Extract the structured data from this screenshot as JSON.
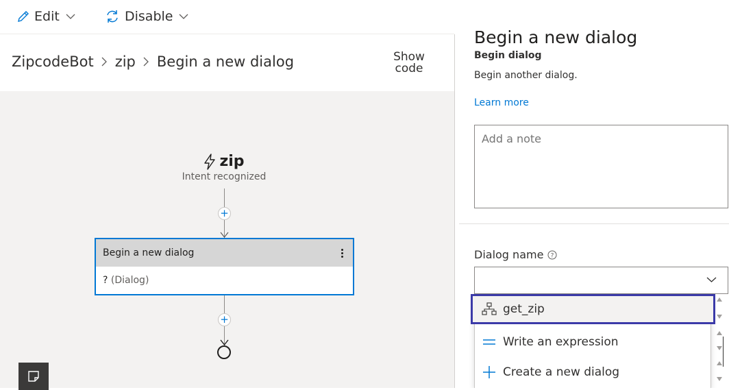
{
  "toolbar": {
    "edit_label": "Edit",
    "disable_label": "Disable"
  },
  "header": {
    "breadcrumb": [
      "ZipcodeBot",
      "zip",
      "Begin a new dialog"
    ],
    "show_code_line1": "Show",
    "show_code_line2": "code"
  },
  "canvas": {
    "trigger_title": "zip",
    "trigger_subtitle": "Intent recognized",
    "node": {
      "title": "Begin a new dialog",
      "body_prefix": "?",
      "body_value": "(Dialog)"
    }
  },
  "panel": {
    "title": "Begin a new dialog",
    "subtitle": "Begin dialog",
    "description": "Begin another dialog.",
    "learn_more": "Learn more",
    "note_placeholder": "Add a note",
    "dialog_name_label": "Dialog name",
    "dialog_name_value": "",
    "dropdown": {
      "items": [
        {
          "label": "get_zip",
          "icon": "dialog-tree-icon",
          "selected": true
        },
        {
          "label": "Write an expression",
          "icon": "expression-icon",
          "selected": false
        },
        {
          "label": "Create a new dialog",
          "icon": "plus-icon",
          "selected": false
        }
      ]
    }
  },
  "colors": {
    "accent": "#0078d4",
    "selection_outline": "#3b3aa8",
    "canvas_bg": "#f3f2f1",
    "node_header": "#d6d6d6"
  }
}
